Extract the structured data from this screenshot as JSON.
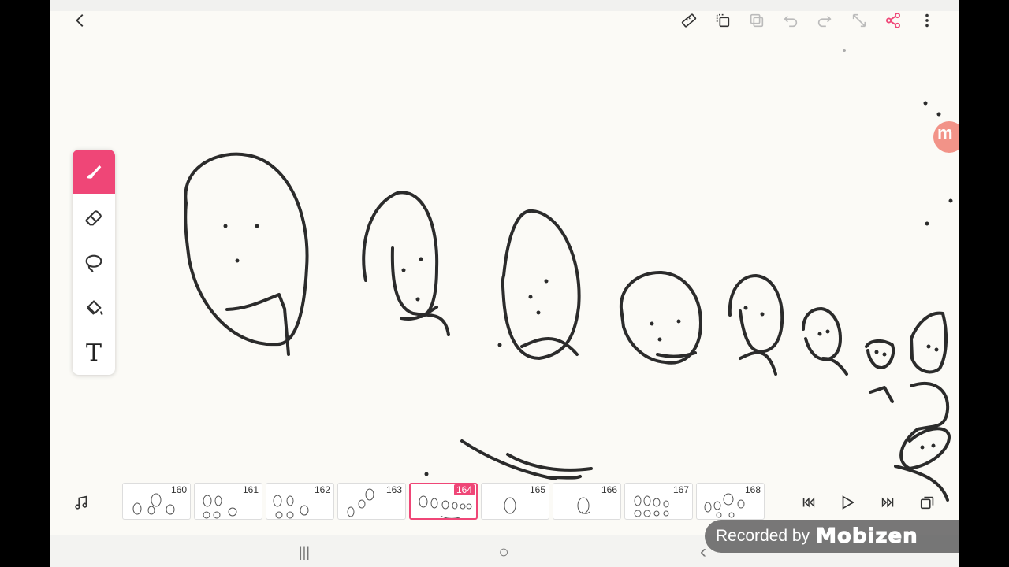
{
  "toolbar": {
    "icons": [
      "back-icon",
      "ruler-icon",
      "duplicate-icon",
      "layers-icon",
      "undo-icon",
      "redo-icon",
      "expand-icon",
      "share-icon",
      "more-icon"
    ],
    "accent_color": "#ef4677"
  },
  "tools": {
    "items": [
      "brush-icon",
      "eraser-icon",
      "lasso-icon",
      "fill-bucket-icon",
      "text-tool"
    ],
    "text_label": "T",
    "active": "brush-icon"
  },
  "timeline": {
    "frames": [
      {
        "number": "160"
      },
      {
        "number": "161"
      },
      {
        "number": "162"
      },
      {
        "number": "163"
      },
      {
        "number": "164",
        "active": true
      },
      {
        "number": "165"
      },
      {
        "number": "166"
      },
      {
        "number": "167"
      },
      {
        "number": "168"
      }
    ],
    "left_icon": "music-icon",
    "controls": [
      "skip-start-icon",
      "play-icon",
      "skip-end-icon",
      "frames-icon"
    ]
  },
  "navbar": {
    "recent": "|||",
    "home": "○",
    "back": "‹"
  },
  "watermark": {
    "text": "Recorded by",
    "logo": "Mobizen"
  },
  "recording_badge": {
    "letter": "m"
  }
}
